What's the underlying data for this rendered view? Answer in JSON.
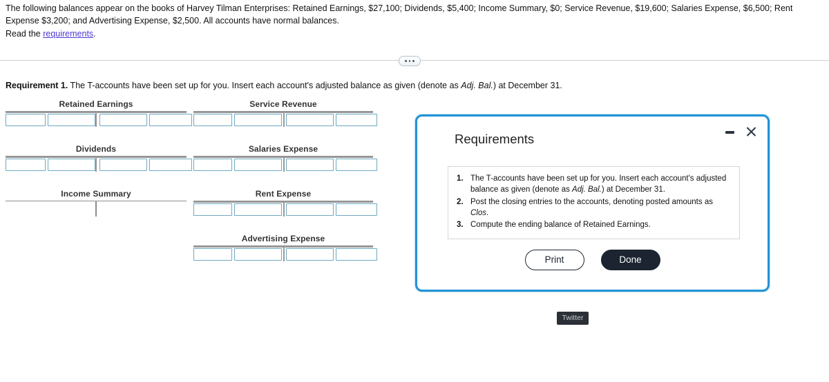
{
  "problem": {
    "statement": "The following balances appear on the books of Harvey Tilman Enterprises: Retained Earnings, $27,100; Dividends, $5,400; Income Summary, $0; Service Revenue, $19,600; Salaries Expense, $6,500; Rent Expense $3,200; and Advertising Expense, $2,500. All accounts have normal balances.",
    "read_prefix": "Read the ",
    "read_link": "requirements",
    "read_suffix": ".",
    "balances": [
      {
        "account": "Retained Earnings",
        "amount": "$27,100"
      },
      {
        "account": "Dividends",
        "amount": "$5,400"
      },
      {
        "account": "Income Summary",
        "amount": "$0"
      },
      {
        "account": "Service Revenue",
        "amount": "$19,600"
      },
      {
        "account": "Salaries Expense",
        "amount": "$6,500"
      },
      {
        "account": "Rent Expense",
        "amount": "$3,200"
      },
      {
        "account": "Advertising Expense",
        "amount": "$2,500"
      }
    ]
  },
  "requirement_line": {
    "label": "Requirement 1.",
    "text_before_italic": " The T-accounts have been set up for you. Insert each account's adjusted balance as given (denote as ",
    "italic": "Adj. Bal.",
    "text_after_italic": ") at December 31."
  },
  "taccounts": {
    "left_column": [
      {
        "title": "Retained Earnings",
        "has_cells": true,
        "cells": [
          "",
          "",
          "",
          ""
        ]
      },
      {
        "title": "Dividends",
        "has_cells": true,
        "cells": [
          "",
          "",
          "",
          ""
        ]
      },
      {
        "title": "Income Summary",
        "has_cells": false,
        "cells": []
      }
    ],
    "right_column": [
      {
        "title": "Service Revenue",
        "has_cells": true,
        "cells": [
          "",
          "",
          "",
          ""
        ]
      },
      {
        "title": "Salaries Expense",
        "has_cells": true,
        "cells": [
          "",
          "",
          "",
          ""
        ]
      },
      {
        "title": "Rent Expense",
        "has_cells": true,
        "cells": [
          "",
          "",
          "",
          ""
        ]
      },
      {
        "title": "Advertising Expense",
        "has_cells": true,
        "cells": [
          "",
          "",
          "",
          ""
        ]
      }
    ]
  },
  "modal": {
    "title": "Requirements",
    "minimize_icon": "minimize-icon",
    "close_icon": "close-icon",
    "items": [
      {
        "number": "1.",
        "before": "The T-accounts have been set up for you. Insert each account's adjusted balance as given (denote as ",
        "italic": "Adj. Bal.",
        "after": ") at December 31."
      },
      {
        "number": "2.",
        "before": "Post the closing entries to the accounts, denoting posted amounts as ",
        "italic": "Clos",
        "after": "."
      },
      {
        "number": "3.",
        "before": "Compute the ending balance of Retained Earnings.",
        "italic": "",
        "after": ""
      }
    ],
    "print_label": "Print",
    "done_label": "Done"
  },
  "twitter": {
    "label": "Twitter"
  },
  "divider": {
    "handle_icon": "ellipsis-handle"
  },
  "colors": {
    "modal_border": "#2393d4",
    "link": "#4b3ad6",
    "input_border": "#6da9c0",
    "done_bg": "#1b2430",
    "rule": "#9a9a9a",
    "twitter_bg": "#2b2f36"
  }
}
